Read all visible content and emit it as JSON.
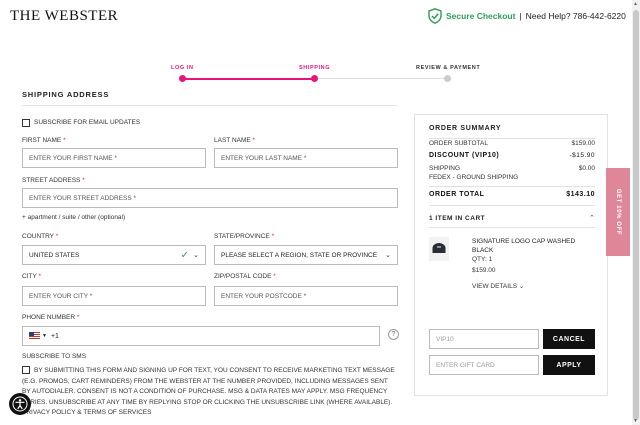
{
  "header": {
    "logo": "THE WEBSTER",
    "secure_text": "Secure Checkout",
    "separator": "|",
    "help_text": "Need Help? 786-442-6220",
    "shield_icon": "shield-check-icon",
    "accent": "#2e9f58"
  },
  "progress": {
    "steps": [
      {
        "label": "LOG IN",
        "state": "done"
      },
      {
        "label": "SHIPPING",
        "state": "active"
      },
      {
        "label": "REVIEW & PAYMENT",
        "state": "todo"
      }
    ],
    "color": "#e8147c"
  },
  "form": {
    "title": "SHIPPING ADDRESS",
    "subscribe_email": "SUBSCRIBE FOR EMAIL UPDATES",
    "first_name": {
      "label": "FIRST NAME",
      "placeholder": "ENTER YOUR FIRST NAME *"
    },
    "last_name": {
      "label": "LAST NAME",
      "placeholder": "ENTER YOUR LAST NAME *"
    },
    "street": {
      "label": "STREET ADDRESS",
      "placeholder": "ENTER YOUR STREET ADDRESS *"
    },
    "optional_link": "+ apartment / suite / other  (optional)",
    "country": {
      "label": "COUNTRY",
      "value": "UNITED STATES"
    },
    "state": {
      "label": "STATE/PROVINCE",
      "value": "PLEASE SELECT A REGION, STATE OR PROVINCE"
    },
    "city": {
      "label": "CITY",
      "placeholder": "ENTER YOUR CITY *"
    },
    "zip": {
      "label": "ZIP/POSTAL CODE",
      "placeholder": "ENTER YOUR POSTCODE *"
    },
    "phone": {
      "label": "PHONE NUMBER",
      "code": "+1"
    },
    "required_mark": "*",
    "help_mark": "?",
    "sms_title": "SUBSCRIBE TO SMS",
    "sms_consent": "BY SUBMITTING THIS FORM AND SIGNING UP FOR TEXT, YOU CONSENT TO RECEIVE MARKETING TEXT MESSAGE (E.G. PROMOS, CART REMINDERS) FROM THE WEBSTER AT THE NUMBER PROVIDED, INCLUDING MESSAGES SENT BY AUTODIALER. CONSENT IS NOT A CONDITION OF PURCHASE. MSG & DATA RATES MAY APPLY. MSG FREQUENCY VARIES. UNSUBSCRIBE AT ANY TIME BY REPLYING STOP OR CLICKING THE UNSUBSCRIBE LINK (WHERE AVAILABLE). PRIVACY POLICY & TERMS OF SERVICES"
  },
  "summary": {
    "title": "ORDER SUMMARY",
    "subtotal_label": "ORDER SUBTOTAL",
    "subtotal": "$159.00",
    "discount_label": "DISCOUNT (VIP10)",
    "discount": "-$15.90",
    "shipping_label": "SHIPPING",
    "shipping_method": "FEDEX - GROUND SHIPPING",
    "shipping": "$0.00",
    "total_label": "ORDER TOTAL",
    "total": "$143.10",
    "items_label": "1 ITEM IN CART",
    "product": {
      "name": "SIGNATURE LOGO CAP WASHED BLACK",
      "qty": "QTY: 1",
      "price": "$159.00",
      "details": "VIEW DETAILS"
    },
    "promo_placeholder": "VIP10",
    "cancel_label": "CANCEL",
    "gift_placeholder": "ENTER GIFT CARD",
    "apply_label": "APPLY"
  },
  "side_tab": {
    "label": "GET 10% OFF",
    "color": "#e08699"
  },
  "accessibility": {
    "icon": "accessibility-icon"
  }
}
